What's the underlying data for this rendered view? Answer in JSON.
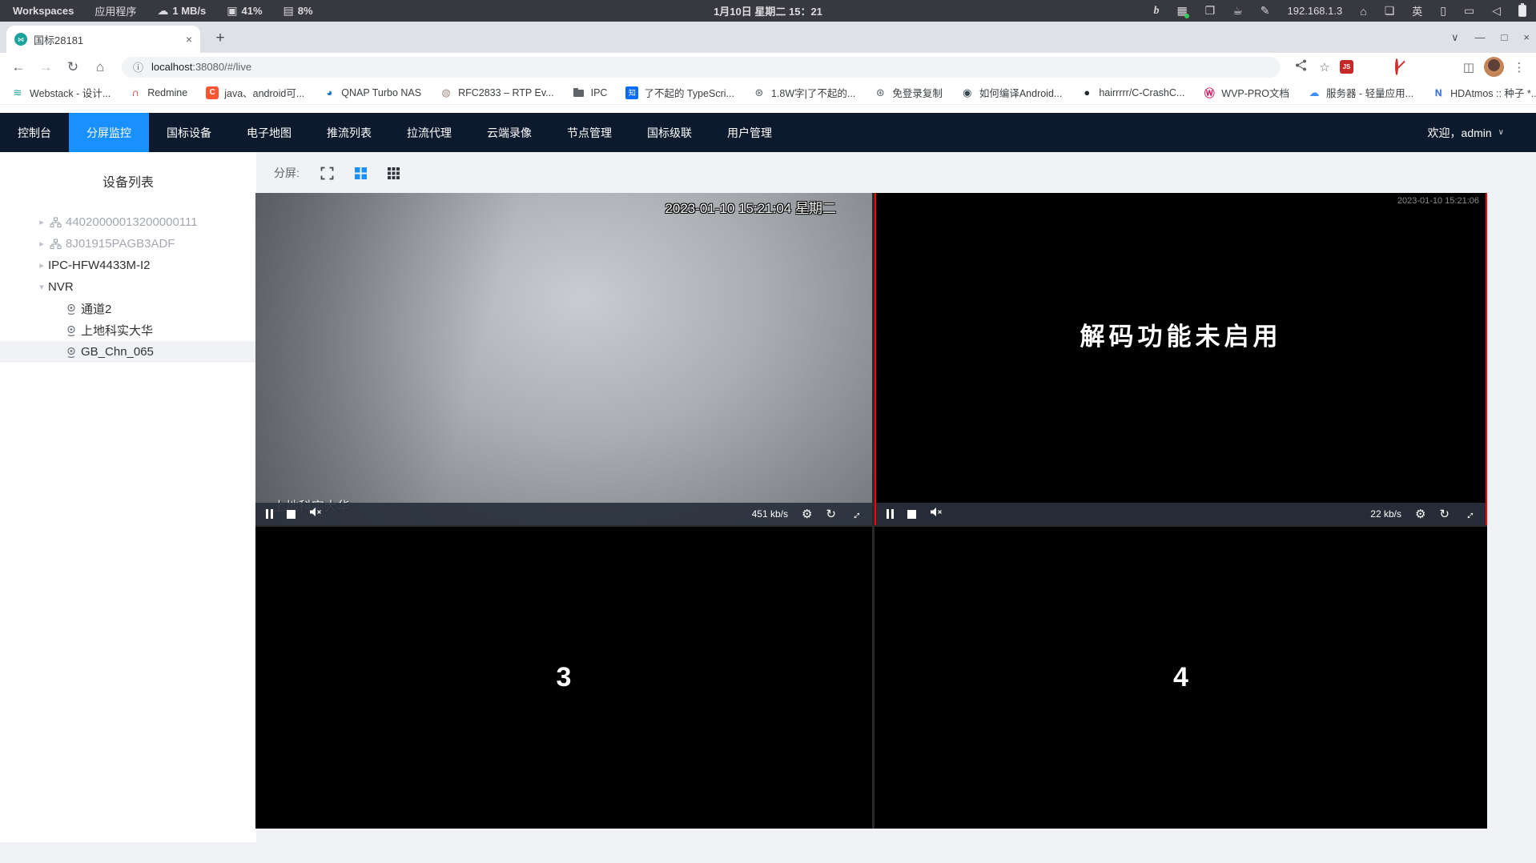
{
  "colors": {
    "accent_blue": "#1890ff",
    "nav_bg": "#0d1a2d",
    "selected_red": "#fb0007"
  },
  "system_bar": {
    "workspaces": "Workspaces",
    "applications": "应用程序",
    "net_speed": "1 MB/s",
    "cpu_pct": "41%",
    "mem_pct": "8%",
    "clock": "1月10日 星期二 15：21",
    "ip": "192.168.1.3",
    "ime": "英"
  },
  "browser": {
    "tab_title": "国标28181",
    "url_host": "localhost",
    "url_rest": ":38080/#/live",
    "bookmarks": [
      {
        "label": "Webstack - 设计..."
      },
      {
        "label": "Redmine"
      },
      {
        "label": "java、android可..."
      },
      {
        "label": "QNAP Turbo NAS"
      },
      {
        "label": "RFC2833 – RTP Ev..."
      },
      {
        "label": "IPC"
      },
      {
        "label": "了不起的 TypeScri..."
      },
      {
        "label": "1.8W字|了不起的..."
      },
      {
        "label": "免登录复制"
      },
      {
        "label": "如何编译Android..."
      },
      {
        "label": "hairrrrr/C-CrashC..."
      },
      {
        "label": "WVP-PRO文档"
      },
      {
        "label": "服务器 - 轻量应用..."
      },
      {
        "label": "HDAtmos :: 种子 *..."
      }
    ]
  },
  "nav": {
    "items": [
      {
        "label": "控制台"
      },
      {
        "label": "分屏监控"
      },
      {
        "label": "国标设备"
      },
      {
        "label": "电子地图"
      },
      {
        "label": "推流列表"
      },
      {
        "label": "拉流代理"
      },
      {
        "label": "云端录像"
      },
      {
        "label": "节点管理"
      },
      {
        "label": "国标级联"
      },
      {
        "label": "用户管理"
      }
    ],
    "welcome": "欢迎，admin"
  },
  "sidebar": {
    "title": "设备列表",
    "tree": [
      {
        "caret": "▸",
        "label": "44020000013200000111"
      },
      {
        "caret": "▸",
        "label": "8J01915PAGB3ADF"
      },
      {
        "caret": "▸",
        "label": "IPC-HFW4433M-I2"
      },
      {
        "caret": "▾",
        "label": "NVR"
      }
    ],
    "nvr_children": [
      {
        "label": "通道2"
      },
      {
        "label": "上地科实大华"
      },
      {
        "label": "GB_Chn_065"
      }
    ]
  },
  "screen_toolbar": {
    "label": "分屏:"
  },
  "videos": {
    "v1": {
      "timestamp": "2023-01-10 15:21:04 星期二",
      "name": "上地科实大华",
      "bitrate": "451 kb/s"
    },
    "v2": {
      "message": "解码功能未启用",
      "timestamp": "2023-01-10 15:21:06",
      "bitrate": "22 kb/s"
    },
    "v3": {
      "number": "3"
    },
    "v4": {
      "number": "4"
    }
  },
  "icons": {
    "cloud_download": "☁",
    "cpu": "▣",
    "memory": "▤",
    "bing": "b",
    "screenshot": "▦",
    "copy": "❐",
    "coffee": "☕",
    "pen": "✎",
    "home": "⌂",
    "windows": "❏",
    "phone": "▯",
    "display": "▭",
    "speaker": "◁",
    "chevron_down": "∨",
    "minimize": "—",
    "maximize": "□",
    "close": "×",
    "new_tab": "+",
    "back": "←",
    "forward": "→",
    "reload": "↻",
    "info": "ⓘ",
    "star": "☆",
    "menu": "⋮",
    "overflow": "»",
    "panel": "◫",
    "welcome_caret": "∨",
    "gear": "⚙",
    "refresh": "↻",
    "expand": "↔",
    "stop": "■",
    "fv_webstack": "≋",
    "fv_redmine": "∩",
    "fv_csdn": "C",
    "fv_qnap": "◕",
    "fv_rfc": "◍",
    "fv_zhihu": "知",
    "fv_globe": "⊛",
    "fv_penguin": "◉",
    "fv_github": "●",
    "fv_wvp": "Ⓦ",
    "fv_tcloud": "☁",
    "fv_hdatmos": "N",
    "tab_favicon": "⋈"
  }
}
